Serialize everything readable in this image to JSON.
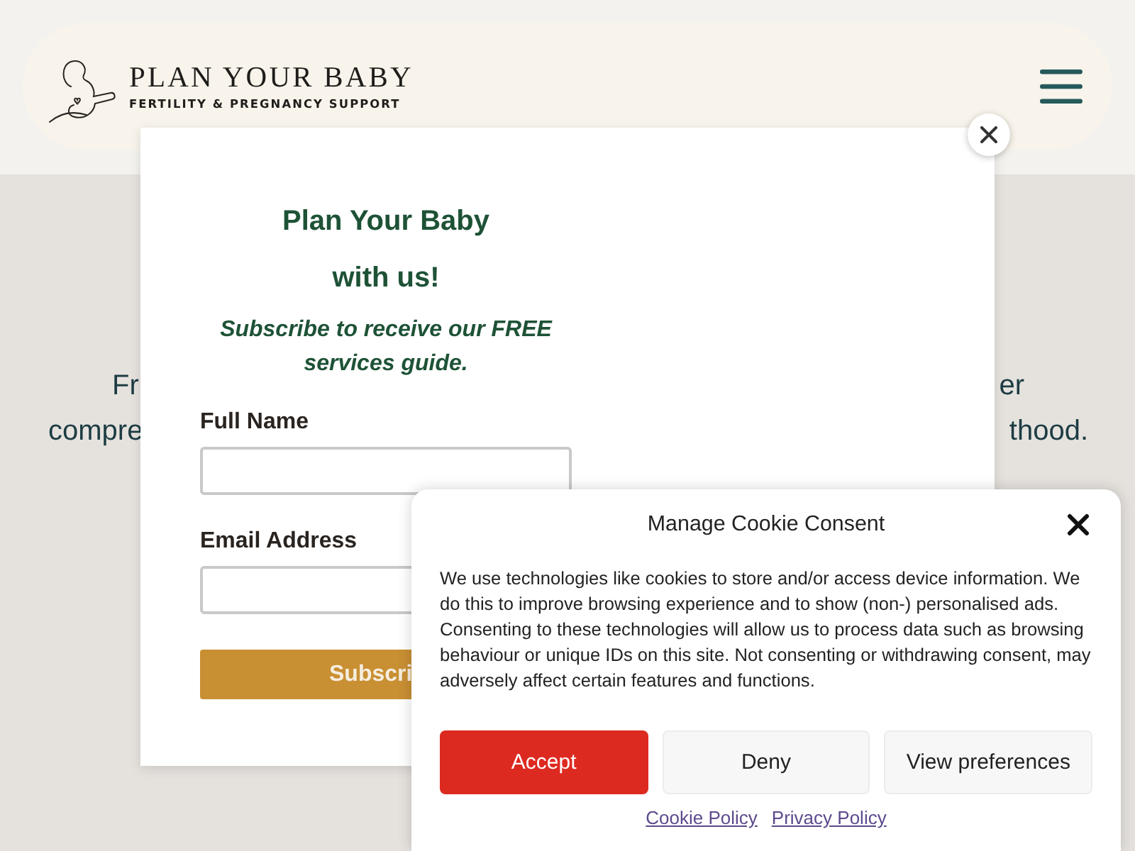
{
  "header": {
    "logo": {
      "title": "PLAN YOUR BABY",
      "tagline": "FERTILITY & PREGNANCY SUPPORT"
    }
  },
  "hero": {
    "lines": [
      {
        "left": "Fr",
        "right": "er"
      },
      {
        "left": "compre",
        "right": "thood."
      }
    ]
  },
  "popup": {
    "title_lines": [
      "Plan Your Baby",
      "with us!"
    ],
    "subtitle": "Subscribe to receive our FREE services guide.",
    "fields": [
      {
        "label": "Full Name"
      },
      {
        "label": "Email Address"
      }
    ],
    "submit": "Subscri"
  },
  "cookie_consent": {
    "title": "Manage Cookie Consent",
    "text": "We use technologies like cookies to store and/or access device information. We do this to improve browsing experience and to show (non-) personalised ads. Consenting to these technologies will allow us to process data such as browsing behaviour or unique IDs on this site. Not consenting or withdrawing consent, may adversely affect certain features and functions.",
    "buttons": [
      {
        "label": "Accept",
        "kind": "primary"
      },
      {
        "label": "Deny",
        "kind": "secondary"
      },
      {
        "label": "View preferences",
        "kind": "secondary"
      }
    ],
    "links": [
      "Cookie Policy",
      "Privacy Policy"
    ]
  }
}
